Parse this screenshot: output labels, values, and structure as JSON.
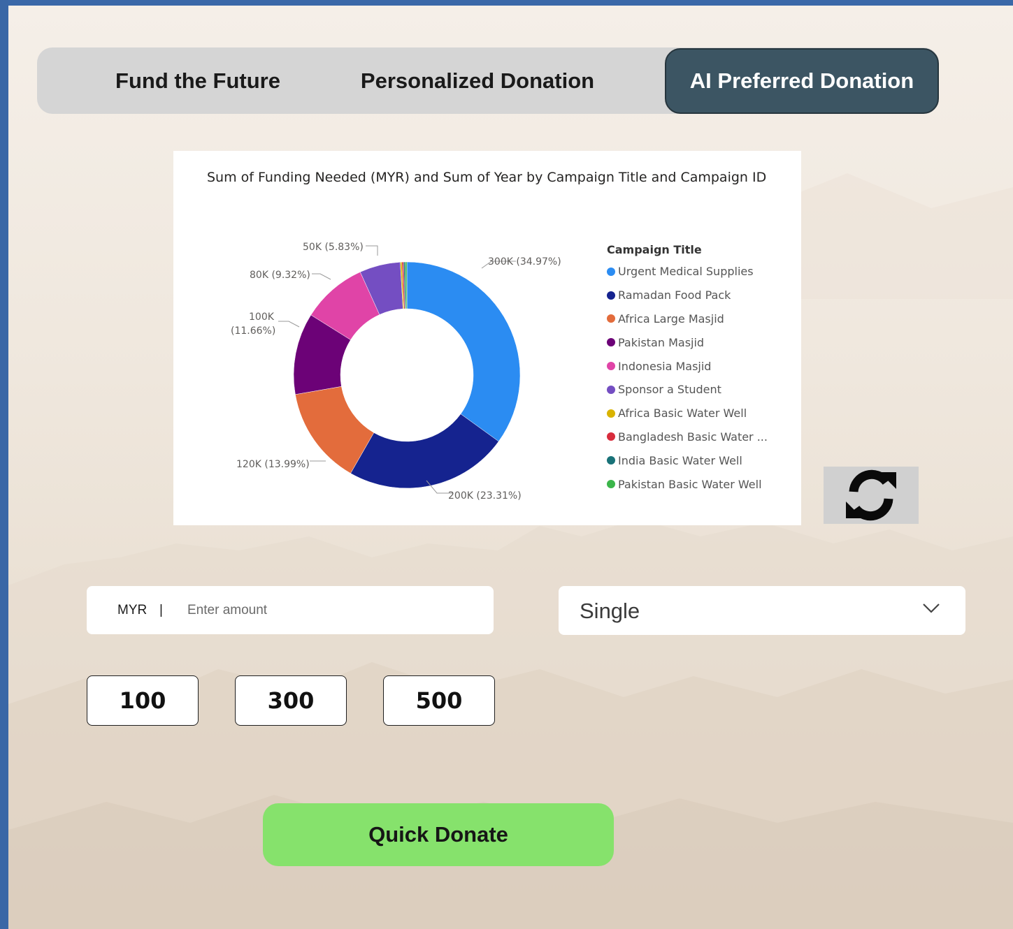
{
  "tabs": [
    {
      "label": "Fund the Future",
      "active": false
    },
    {
      "label": "Personalized Donation",
      "active": false
    },
    {
      "label": "AI Preferred Donation",
      "active": true
    }
  ],
  "chart": {
    "title": "Sum of Funding Needed (MYR) and Sum of Year by Campaign Title and Campaign ID",
    "legend_title": "Campaign Title",
    "slice_labels": [
      "300K (34.97%)",
      "200K (23.31%)",
      "120K (13.99%)",
      "100K",
      "(11.66%)",
      "80K (9.32%)",
      "50K (5.83%)"
    ]
  },
  "chart_data": {
    "type": "pie",
    "title": "Sum of Funding Needed (MYR) and Sum of Year by Campaign Title and Campaign ID",
    "legend_title": "Campaign Title",
    "legend_position": "right",
    "categories": [
      "Urgent Medical Supplies",
      "Ramadan Food Pack",
      "Africa Large Masjid",
      "Pakistan Masjid",
      "Indonesia Masjid",
      "Sponsor a Student",
      "Africa Basic Water Well",
      "Bangladesh Basic Water ...",
      "India Basic Water Well",
      "Pakistan Basic Water Well"
    ],
    "values": [
      300000,
      200000,
      120000,
      100000,
      80000,
      50000,
      2000,
      2000,
      2000,
      2000
    ],
    "colors": [
      "#2b8cf2",
      "#15238f",
      "#e36c3c",
      "#6c0277",
      "#e044a7",
      "#744ec2",
      "#d9b300",
      "#d82c3c",
      "#197278",
      "#3bb54a"
    ],
    "data_labels": [
      "300K (34.97%)",
      "200K (23.31%)",
      "120K (13.99%)",
      "100K (11.66%)",
      "80K (9.32%)",
      "50K (5.83%)"
    ]
  },
  "refresh": {
    "icon": "refresh-icon"
  },
  "donation_form": {
    "currency": "MYR",
    "separator": "|",
    "amount_placeholder": "Enter amount",
    "amount_value": "",
    "frequency": "Single",
    "preset_amounts": [
      "100",
      "300",
      "500"
    ],
    "submit_label": "Quick Donate"
  },
  "colors": {
    "active_tab": "#3c5563",
    "tabbar": "#d5d5d5",
    "donate_button": "#86e26c",
    "background": "#efe7dd"
  }
}
